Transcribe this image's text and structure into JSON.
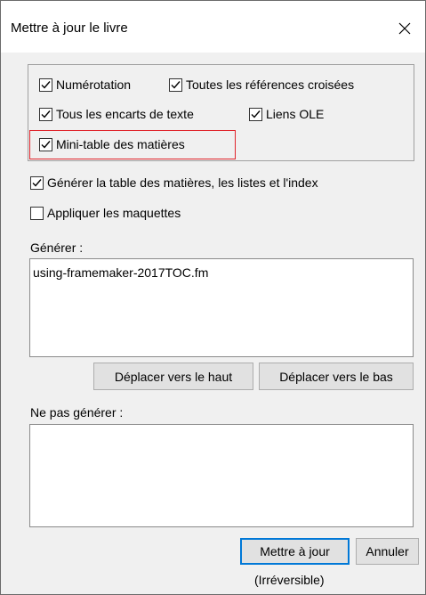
{
  "window": {
    "title": "Mettre à jour le livre"
  },
  "options_group": {
    "numbering": {
      "label": "Numérotation",
      "checked": true
    },
    "cross_refs": {
      "label": "Toutes les références croisées",
      "checked": true
    },
    "text_insets": {
      "label": "Tous les encarts de texte",
      "checked": true
    },
    "ole_links": {
      "label": "Liens OLE",
      "checked": true
    },
    "mini_toc": {
      "label": "Mini-table des matières",
      "checked": true
    }
  },
  "generate_toc": {
    "label": "Générer la table des matières, les listes et l'index",
    "checked": true
  },
  "apply_master_pages": {
    "label": "Appliquer les maquettes",
    "checked": false
  },
  "generate_list": {
    "label": "Générer :",
    "items": [
      "using-framemaker-2017TOC.fm"
    ]
  },
  "move_buttons": {
    "up": "Déplacer vers le haut",
    "down": "Déplacer vers le bas"
  },
  "dont_generate_list": {
    "label": "Ne pas générer :",
    "items": []
  },
  "footer": {
    "update_button": "Mettre à jour",
    "cancel_button": "Annuler",
    "irreversible_note": "(Irréversible)"
  },
  "colors": {
    "highlight": "#e0242b",
    "default_button_border": "#0078d7"
  },
  "icons": {
    "close": "close-icon",
    "check": "checkmark-icon"
  }
}
